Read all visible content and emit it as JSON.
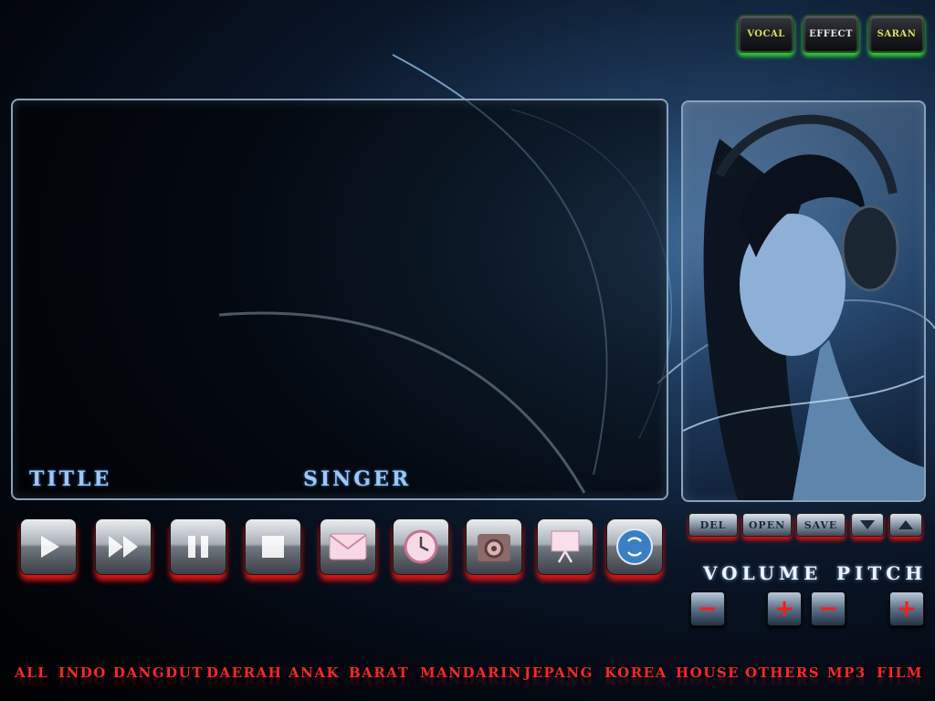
{
  "top_buttons": {
    "vocal": "VOCAL",
    "effect": "EFFECT",
    "saran": "SARAN"
  },
  "panel": {
    "title_label": "TITLE",
    "singer_label": "SINGER"
  },
  "playback_controls": [
    {
      "name": "play",
      "icon": "play-icon"
    },
    {
      "name": "fast-forward",
      "icon": "fast-forward-icon"
    },
    {
      "name": "pause",
      "icon": "pause-icon"
    },
    {
      "name": "stop",
      "icon": "stop-icon"
    },
    {
      "name": "message",
      "icon": "envelope-icon"
    },
    {
      "name": "timer",
      "icon": "clock-icon"
    },
    {
      "name": "settings",
      "icon": "gear-icon"
    },
    {
      "name": "presentation",
      "icon": "presentation-board-icon"
    },
    {
      "name": "repeat",
      "icon": "repeat-icon"
    }
  ],
  "playlist_buttons": {
    "del": "DEL",
    "open": "OPEN",
    "save": "SAVE"
  },
  "volume": {
    "label": "VOLUME",
    "minus": "−",
    "plus": "+"
  },
  "pitch": {
    "label": "PITCH",
    "minus": "−",
    "plus": "+"
  },
  "categories": [
    "ALL",
    "INDO",
    "DANGDUT",
    "DAERAH",
    "ANAK",
    "BARAT",
    "MANDARIN",
    "JEPANG",
    "KOREA",
    "HOUSE",
    "OTHERS",
    "MP3",
    "FILM"
  ],
  "colors": {
    "accent_red": "#ff2626",
    "accent_green": "#2bd42b",
    "panel_border": "#8aa1b8",
    "label_blue": "#9ec8f2"
  }
}
